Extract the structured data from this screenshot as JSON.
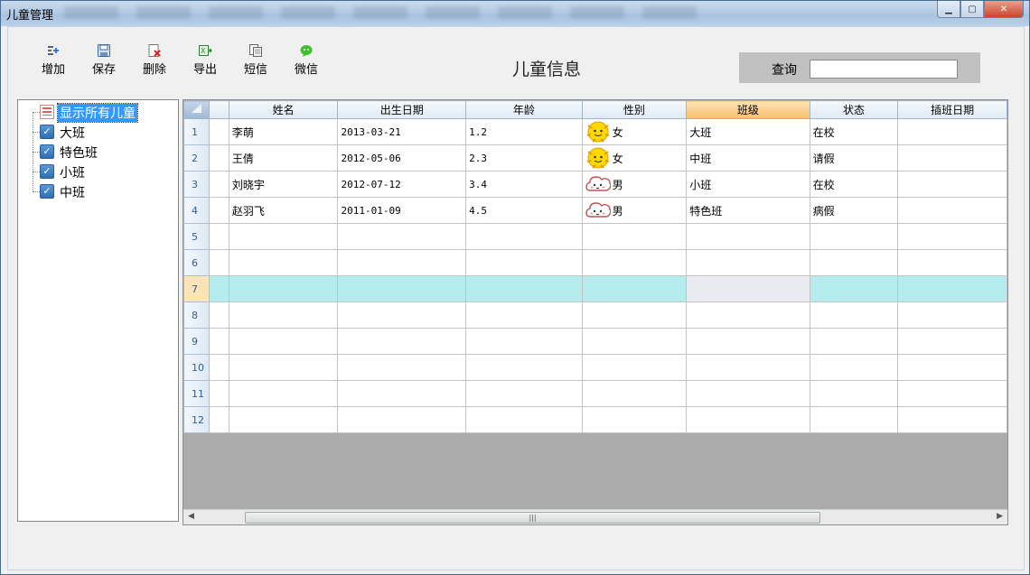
{
  "window": {
    "title": "儿童管理"
  },
  "toolbar": {
    "items": [
      {
        "label": "增加",
        "icon": "add-icon"
      },
      {
        "label": "保存",
        "icon": "save-icon"
      },
      {
        "label": "删除",
        "icon": "delete-icon"
      },
      {
        "label": "导出",
        "icon": "export-icon"
      },
      {
        "label": "短信",
        "icon": "sms-icon"
      },
      {
        "label": "微信",
        "icon": "wechat-icon"
      }
    ]
  },
  "page": {
    "title": "儿童信息"
  },
  "search": {
    "label": "查询",
    "value": ""
  },
  "tree": {
    "items": [
      {
        "label": "显示所有儿童",
        "selected": true,
        "icon": "list-icon"
      },
      {
        "label": "大班",
        "selected": false,
        "icon": "checkbox-icon"
      },
      {
        "label": "特色班",
        "selected": false,
        "icon": "checkbox-icon"
      },
      {
        "label": "小班",
        "selected": false,
        "icon": "checkbox-icon"
      },
      {
        "label": "中班",
        "selected": false,
        "icon": "checkbox-icon"
      }
    ]
  },
  "grid": {
    "columns": [
      "",
      "姓名",
      "出生日期",
      "年龄",
      "性别",
      "班级",
      "状态",
      "插班日期"
    ],
    "active_column": "班级",
    "current_row": 7,
    "rows": [
      {
        "num": "1",
        "name": "李萌",
        "birth": "2013-03-21",
        "age": "1.2",
        "gender": "女",
        "gender_icon": "sun-face-icon",
        "class": "大班",
        "status": "在校",
        "join": ""
      },
      {
        "num": "2",
        "name": "王倩",
        "birth": "2012-05-06",
        "age": "2.3",
        "gender": "女",
        "gender_icon": "sun-face-icon",
        "class": "中班",
        "status": "请假",
        "join": ""
      },
      {
        "num": "3",
        "name": "刘晓宇",
        "birth": "2012-07-12",
        "age": "3.4",
        "gender": "男",
        "gender_icon": "cloud-face-icon",
        "class": "小班",
        "status": "在校",
        "join": ""
      },
      {
        "num": "4",
        "name": "赵羽飞",
        "birth": "2011-01-09",
        "age": "4.5",
        "gender": "男",
        "gender_icon": "cloud-face-icon",
        "class": "特色班",
        "status": "病假",
        "join": ""
      },
      {
        "num": "5",
        "name": "",
        "birth": "",
        "age": "",
        "gender": "",
        "gender_icon": "",
        "class": "",
        "status": "",
        "join": ""
      },
      {
        "num": "6",
        "name": "",
        "birth": "",
        "age": "",
        "gender": "",
        "gender_icon": "",
        "class": "",
        "status": "",
        "join": ""
      },
      {
        "num": "7",
        "name": "",
        "birth": "",
        "age": "",
        "gender": "",
        "gender_icon": "",
        "class": "",
        "status": "",
        "join": ""
      },
      {
        "num": "8",
        "name": "",
        "birth": "",
        "age": "",
        "gender": "",
        "gender_icon": "",
        "class": "",
        "status": "",
        "join": ""
      },
      {
        "num": "9",
        "name": "",
        "birth": "",
        "age": "",
        "gender": "",
        "gender_icon": "",
        "class": "",
        "status": "",
        "join": ""
      },
      {
        "num": "10",
        "name": "",
        "birth": "",
        "age": "",
        "gender": "",
        "gender_icon": "",
        "class": "",
        "status": "",
        "join": ""
      },
      {
        "num": "11",
        "name": "",
        "birth": "",
        "age": "",
        "gender": "",
        "gender_icon": "",
        "class": "",
        "status": "",
        "join": ""
      },
      {
        "num": "12",
        "name": "",
        "birth": "",
        "age": "",
        "gender": "",
        "gender_icon": "",
        "class": "",
        "status": "",
        "join": ""
      }
    ]
  },
  "colors": {
    "current_row": "#b4ecee",
    "active_header": "#f9bf6b",
    "selection": "#3399ff",
    "grid_background": "#ababab"
  }
}
